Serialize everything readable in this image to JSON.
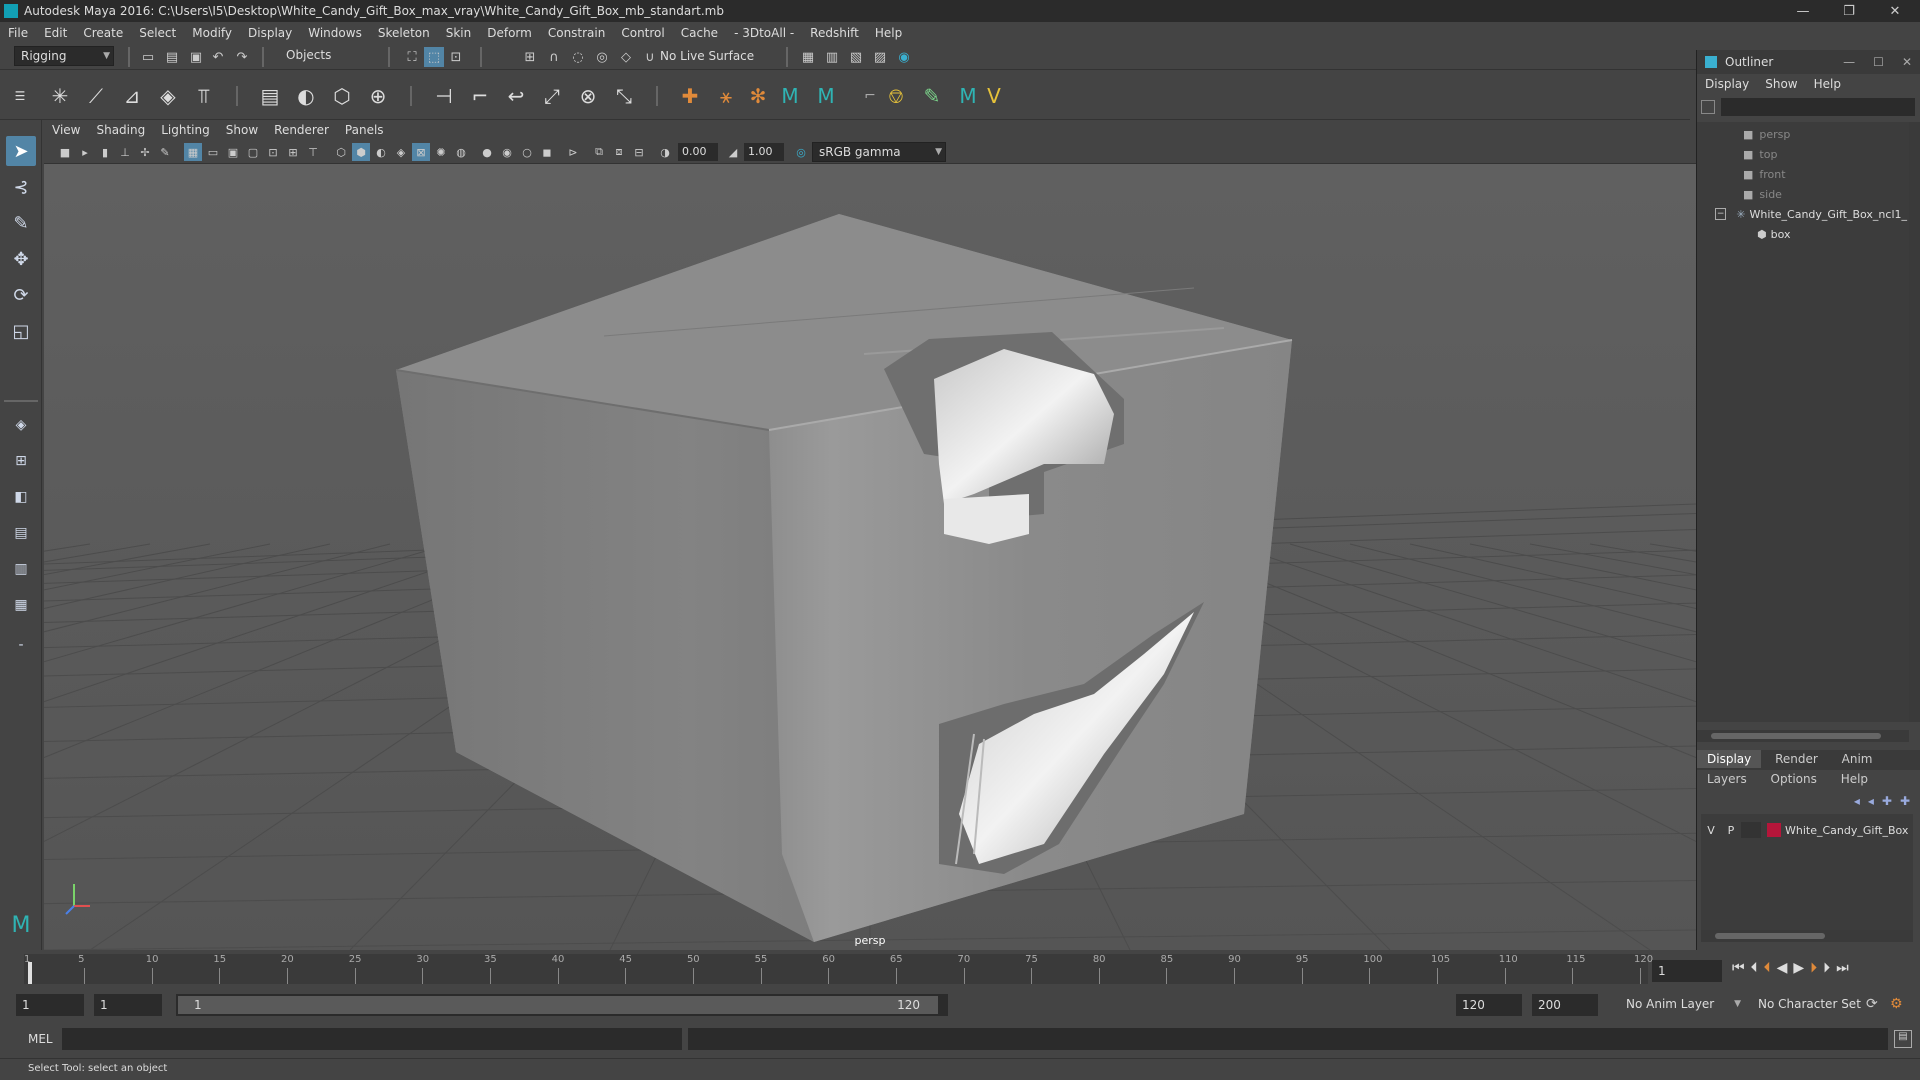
{
  "titlebar": {
    "title": "Autodesk Maya 2016: C:\\Users\\I5\\Desktop\\White_Candy_Gift_Box_max_vray\\White_Candy_Gift_Box_mb_standart.mb"
  },
  "menubar": [
    "File",
    "Edit",
    "Create",
    "Select",
    "Modify",
    "Display",
    "Windows",
    "Skeleton",
    "Skin",
    "Deform",
    "Constrain",
    "Control",
    "Cache",
    "- 3DtoAll -",
    "Redshift",
    "Help"
  ],
  "statusline": {
    "mode": "Rigging",
    "selection_mask": "Objects",
    "live_surface": "No Live Surface"
  },
  "viewport": {
    "menus": [
      "View",
      "Shading",
      "Lighting",
      "Show",
      "Renderer",
      "Panels"
    ],
    "exposure": "0.00",
    "gamma": "1.00",
    "color_space": "sRGB gamma",
    "camera": "persp"
  },
  "outliner": {
    "title": "Outliner",
    "menus": [
      "Display",
      "Show",
      "Help"
    ],
    "items": [
      {
        "label": "persp"
      },
      {
        "label": "top"
      },
      {
        "label": "front"
      },
      {
        "label": "side"
      },
      {
        "label": "White_Candy_Gift_Box_ncl1_"
      },
      {
        "label": "box"
      }
    ]
  },
  "layers": {
    "tabs": [
      "Display",
      "Render",
      "Anim"
    ],
    "menus": [
      "Layers",
      "Options",
      "Help"
    ],
    "row": {
      "v": "V",
      "p": "P",
      "name": "White_Candy_Gift_Box",
      "color": "#b5163a"
    }
  },
  "timeline": {
    "ticks": [
      "1",
      "5",
      "10",
      "15",
      "20",
      "25",
      "30",
      "35",
      "40",
      "45",
      "50",
      "55",
      "60",
      "65",
      "70",
      "75",
      "80",
      "85",
      "90",
      "95",
      "100",
      "105",
      "110",
      "115",
      "120"
    ],
    "current_frame": "1"
  },
  "range": {
    "start": "1",
    "start_inner": "1",
    "slider_start": "1",
    "slider_end": "120",
    "end_inner": "120",
    "end": "200",
    "anim_layer": "No Anim Layer",
    "character_set": "No Character Set"
  },
  "cmdline": {
    "lang": "MEL"
  },
  "helpline": {
    "text": "Select Tool: select an object"
  }
}
